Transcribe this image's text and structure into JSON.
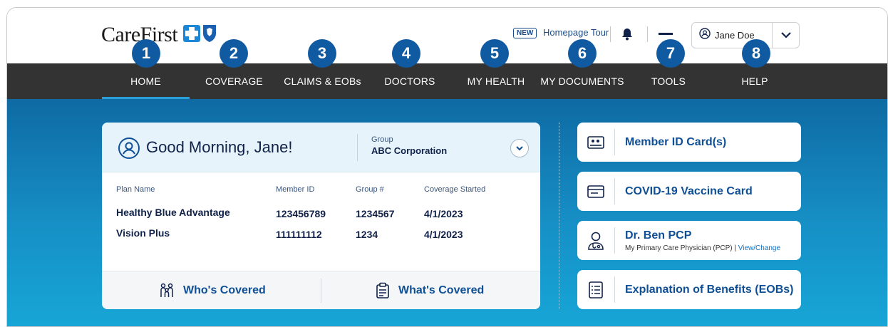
{
  "header": {
    "logo_text": "CareFirst",
    "new_badge": "NEW",
    "tour_link": "Homepage Tour",
    "user_name": "Jane Doe"
  },
  "callouts": [
    "1",
    "2",
    "3",
    "4",
    "5",
    "6",
    "7",
    "8"
  ],
  "nav": {
    "items": [
      {
        "label": "HOME",
        "active": true
      },
      {
        "label": "COVERAGE"
      },
      {
        "label": "CLAIMS & EOBs"
      },
      {
        "label": "DOCTORS"
      },
      {
        "label": "MY HEALTH"
      },
      {
        "label": "MY DOCUMENTS"
      },
      {
        "label": "TOOLS"
      },
      {
        "label": "HELP"
      }
    ]
  },
  "card": {
    "greeting": "Good Morning, Jane!",
    "group_label": "Group",
    "group_value": "ABC Corporation",
    "columns": [
      "Plan Name",
      "Member ID",
      "Group #",
      "Coverage Started"
    ],
    "rows": [
      [
        "Healthy Blue Advantage",
        "123456789",
        "1234567",
        "4/1/2023"
      ],
      [
        "Vision Plus",
        "111111112",
        "1234",
        "4/1/2023"
      ]
    ],
    "whos_covered": "Who's Covered",
    "whats_covered": "What's Covered"
  },
  "quick_links": {
    "member_id": "Member ID Card(s)",
    "covid": "COVID-19 Vaccine Card",
    "pcp_name": "Dr. Ben PCP",
    "pcp_sub": "My Primary Care Physician (PCP) |",
    "pcp_link": "View/Change",
    "eob": "Explanation of Benefits (EOBs)"
  },
  "colors": {
    "nav_bg": "#333333",
    "accent": "#0f5aa1",
    "brand_blue": "#0f4f96"
  }
}
